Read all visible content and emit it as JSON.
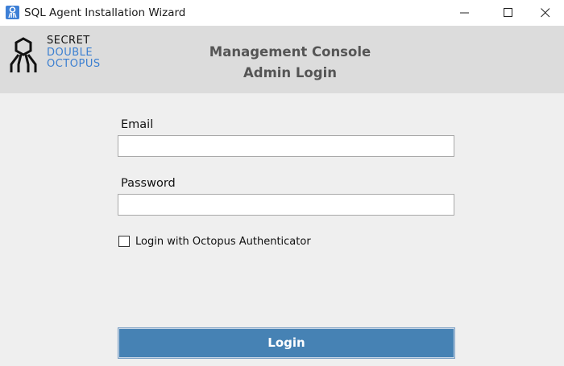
{
  "window": {
    "title": "SQL Agent Installation Wizard",
    "icon": "octopus-app-icon",
    "controls": [
      "minimize-icon",
      "maximize-icon",
      "close-icon"
    ]
  },
  "header": {
    "logo": {
      "line1": "SECRET",
      "line2": "DOUBLE",
      "line3": "OCTOPUS",
      "accent_color": "#3b7fd1"
    },
    "title_line1": "Management Console",
    "title_line2": "Admin Login"
  },
  "form": {
    "email_label": "Email",
    "email_value": "",
    "password_label": "Password",
    "password_value": "",
    "authenticator_checkbox_label": "Login with Octopus Authenticator",
    "authenticator_checked": false
  },
  "login_button_label": "Login",
  "colors": {
    "header_background": "#dcdcdc",
    "body_background": "#efefef",
    "button_background": "#4682b4",
    "title_color": "#555555"
  }
}
